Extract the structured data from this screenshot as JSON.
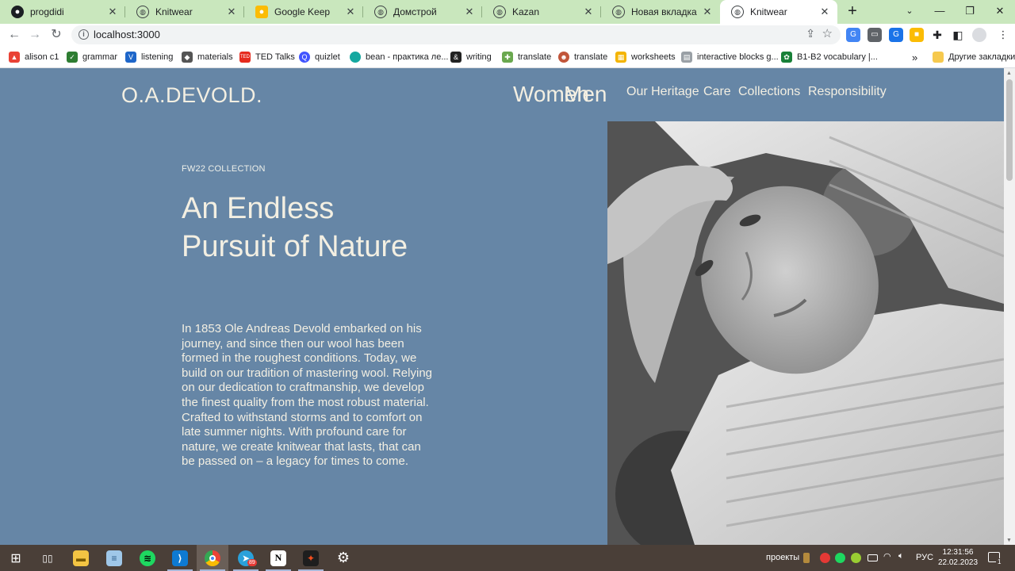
{
  "browser": {
    "tabs": [
      {
        "title": "progdidi",
        "icon": "github-icon",
        "active": false
      },
      {
        "title": "Knitwear",
        "icon": "globe-icon",
        "active": false
      },
      {
        "title": "Google Keep",
        "icon": "keep-icon",
        "active": false
      },
      {
        "title": "Домстрой",
        "icon": "globe-icon",
        "active": false
      },
      {
        "title": "Kazan",
        "icon": "globe-icon",
        "active": false
      },
      {
        "title": "Новая вкладка",
        "icon": "globe-icon",
        "active": false
      },
      {
        "title": "Knitwear",
        "icon": "globe-icon",
        "active": true
      }
    ],
    "address": "localhost:3000",
    "bookmarks": [
      {
        "label": "alison c1",
        "color": "#e94235"
      },
      {
        "label": "grammar",
        "color": "#2e7d32"
      },
      {
        "label": "listening",
        "color": "#1e66c9"
      },
      {
        "label": "materials",
        "color": "#555555"
      },
      {
        "label": "TED Talks",
        "color": "#e62b1e"
      },
      {
        "label": "quizlet",
        "color": "#4255ff"
      },
      {
        "label": "bean - практика ле...",
        "color": "#15a8a0"
      },
      {
        "label": "writing",
        "color": "#222222"
      },
      {
        "label": "translate",
        "color": "#6aa84f"
      },
      {
        "label": "translate",
        "color": "#c1553a"
      },
      {
        "label": "worksheets",
        "color": "#f4b400"
      },
      {
        "label": "interactive blocks g...",
        "color": "#9aa0a6"
      },
      {
        "label": "B1-B2 vocabulary |...",
        "color": "#188038"
      }
    ],
    "more_bookmarks": "»",
    "other_bookmarks": "Другие закладки"
  },
  "site": {
    "logo": "O.A.DEVOLD.",
    "nav_primary": [
      "Women",
      "Men"
    ],
    "nav_secondary": [
      "Our Heritage",
      "Care",
      "Collections",
      "Responsibility"
    ],
    "eyebrow": "FW22 COLLECTION",
    "headline": "An Endless Pursuit of Nature",
    "body": "In 1853 Ole Andreas Devold embarked on his journey, and since then our wool has been formed in the roughest conditions. Today, we build on our tradition of mastering wool. Relying on our dedication to craftmanship, we develop the finest quality from the most robust material. Crafted to withstand storms and to comfort on late summer nights. With profound care for nature, we create knitwear that lasts, that can be passed on – a legacy for times to come.",
    "colors": {
      "background": "#6686a6",
      "text": "#f3efe2"
    }
  },
  "taskbar": {
    "apps": [
      "windows-start-icon",
      "task-view-icon",
      "file-explorer-icon",
      "notepad-icon",
      "spotify-icon",
      "vscode-icon",
      "chrome-icon",
      "telegram-icon",
      "notion-icon",
      "figma-icon",
      "settings-icon"
    ],
    "telegram_badge": "89",
    "tray_label": "проекты",
    "language": "РУС",
    "time": "12:31:56",
    "date": "22.02.2023",
    "notification_count": "1"
  }
}
